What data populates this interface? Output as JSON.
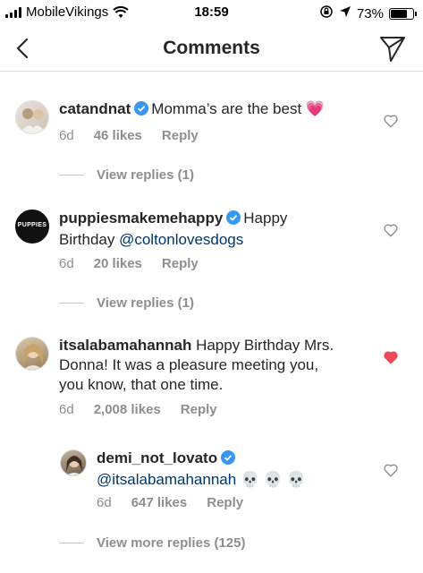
{
  "status_bar": {
    "carrier": "MobileVikings",
    "time": "18:59",
    "battery": "73%",
    "battery_level": 0.73
  },
  "header": {
    "title": "Comments",
    "back_icon": "chevron-left-icon",
    "send_icon": "direct-send-icon"
  },
  "comments": [
    {
      "username": "catandnat",
      "verified": true,
      "text": "Momma’s are the best 💗",
      "time": "6d",
      "likes": "46 likes",
      "reply": "Reply",
      "liked": false,
      "view_replies": "View replies (1)"
    },
    {
      "username": "puppiesmakemehappy",
      "verified": true,
      "text_before": "Happy",
      "text_line2": "Birthday ",
      "mention": "@coltonlovesdogs",
      "avatar_text": "PUPPIES",
      "time": "6d",
      "likes": "20 likes",
      "reply": "Reply",
      "liked": false,
      "view_replies": "View replies (1)"
    },
    {
      "username": "itsalabamahannah",
      "verified": false,
      "text_line1": "Happy Birthday Mrs.",
      "text_line2": "Donna! It was a pleasure meeting you,",
      "text_line3": "you know, that one time.",
      "time": "6d",
      "likes": "2,008 likes",
      "reply": "Reply",
      "liked": true,
      "like_color": "#ed4956"
    }
  ],
  "reply": {
    "username": "demi_not_lovato",
    "verified": true,
    "mention": "@itsalabamahannah",
    "emoji": "💀 💀 💀",
    "time": "6d",
    "likes": "647 likes",
    "reply": "Reply",
    "liked": false
  },
  "view_more_replies": "View more replies (125)",
  "colors": {
    "verified": "#3897f0",
    "secondary_text": "#8e8e8e",
    "mention": "#003569"
  }
}
